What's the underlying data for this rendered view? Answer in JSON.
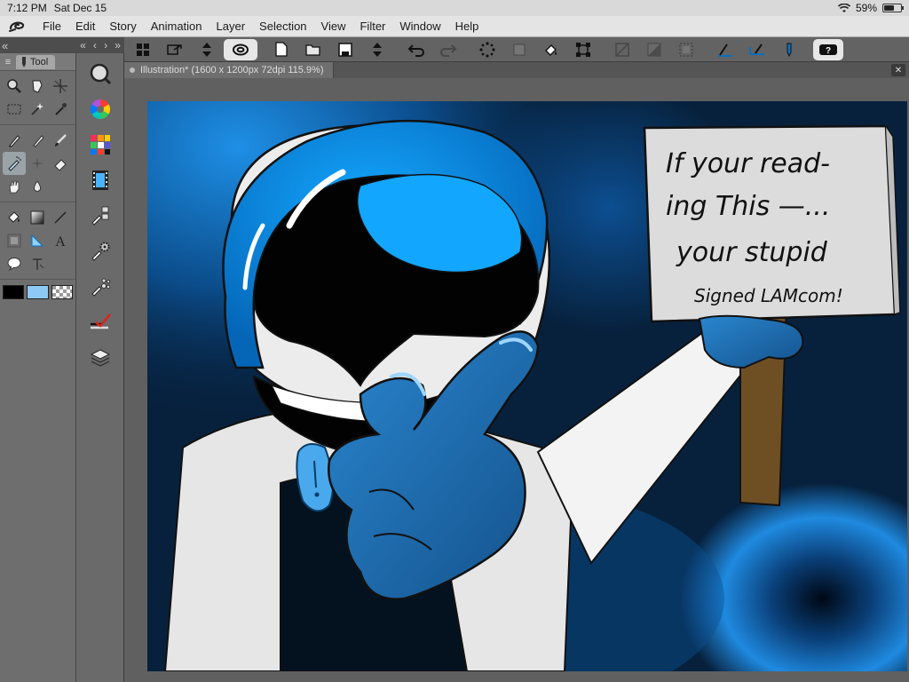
{
  "status": {
    "time": "7:12 PM",
    "date": "Sat Dec 15",
    "battery": "59%",
    "battery_level": 0.59
  },
  "menu": [
    "File",
    "Edit",
    "Story",
    "Animation",
    "Layer",
    "Selection",
    "View",
    "Filter",
    "Window",
    "Help"
  ],
  "tool_palette": {
    "tab_label": "Tool"
  },
  "document": {
    "tab_title": "Illustration* (1600 x 1200px 72dpi 115.9%)"
  },
  "artwork": {
    "sign_lines": [
      "If your read-",
      "ing This —...",
      "your stupid",
      "Signed LAMcom!"
    ]
  },
  "colors": {
    "main_color": "#000000",
    "sub_color": "#8ec9f5",
    "accent": "#1a8fe6"
  },
  "icons": {
    "commands": [
      "grid-icon",
      "export-icon",
      "arrows-icon",
      "brush-settings-icon",
      "new-page-icon",
      "open-icon",
      "save-icon",
      "arrows-icon",
      "undo-icon",
      "redo-icon",
      "selection-icon",
      "transform-icon",
      "fill-icon",
      "free-transform-icon",
      "clear-icon",
      "tone-icon",
      "select-all-icon",
      "ruler-icon",
      "ruler-icon",
      "pen-icon",
      "help-icon"
    ]
  }
}
